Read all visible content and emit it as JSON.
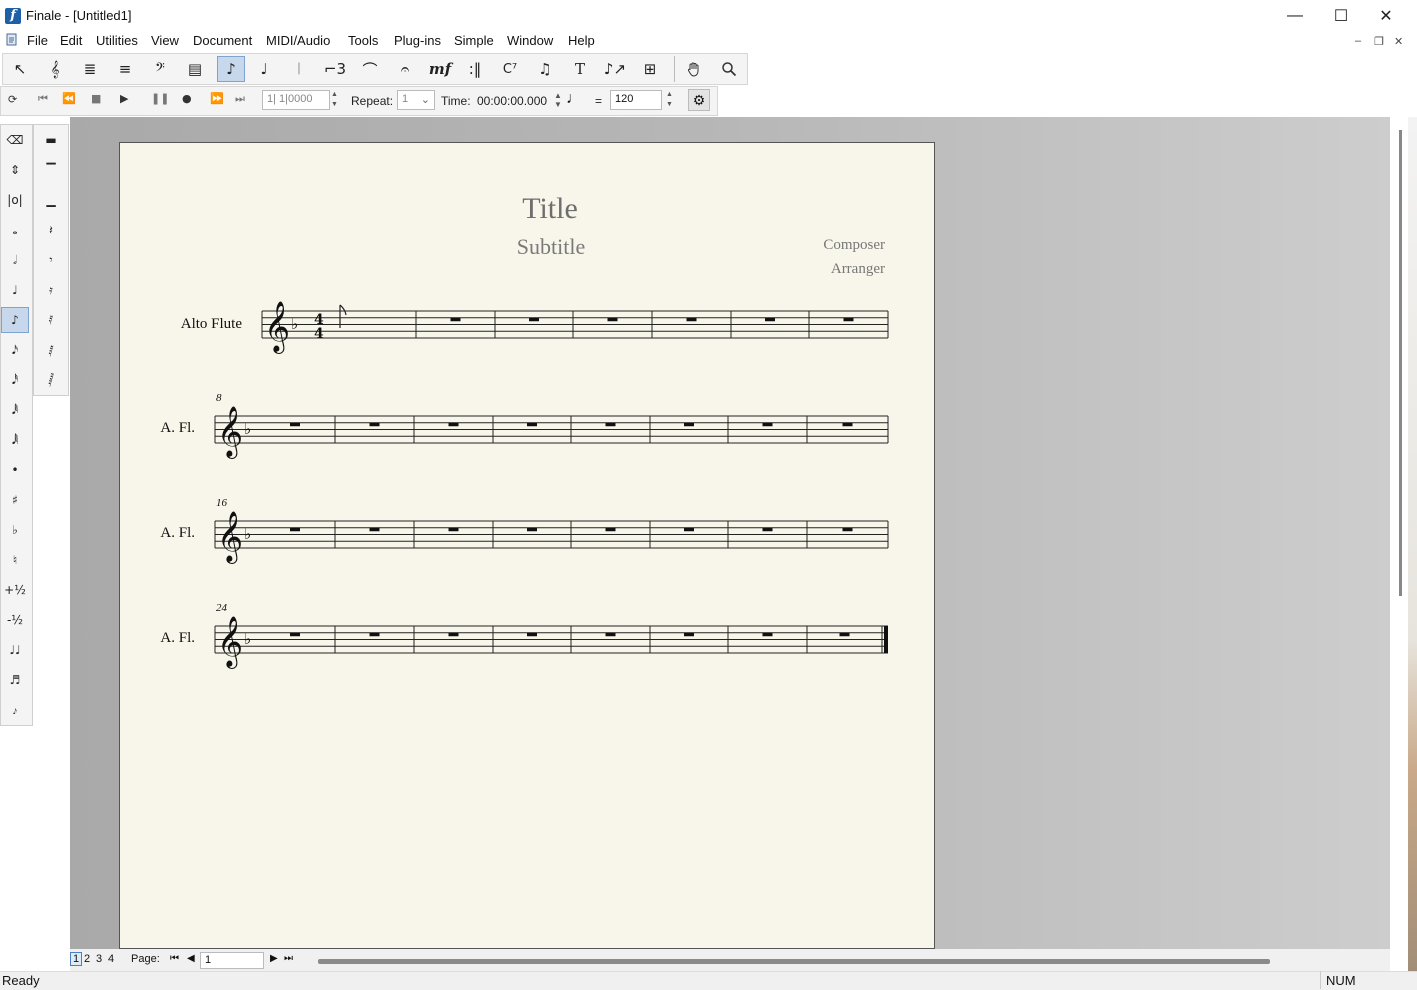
{
  "window": {
    "title": "Finale - [Untitled1]",
    "app_icon_glyph": "f"
  },
  "menu": [
    "File",
    "Edit",
    "Utilities",
    "View",
    "Document",
    "MIDI/Audio",
    "Tools",
    "Plug-ins",
    "Simple",
    "Window",
    "Help"
  ],
  "main_toolbar": [
    {
      "name": "selection-tool-icon",
      "glyph": "↖"
    },
    {
      "name": "staff-tool-icon",
      "glyph": "𝄞"
    },
    {
      "name": "simple-entry-staff-icon",
      "glyph": "≣"
    },
    {
      "name": "layer-staff-icon",
      "glyph": "≡"
    },
    {
      "name": "bass-clef-tool-icon",
      "glyph": "𝄢"
    },
    {
      "name": "measure-tool-icon",
      "glyph": "▤"
    },
    {
      "name": "simple-entry-tool-icon",
      "glyph": "♪",
      "active": true
    },
    {
      "name": "speedy-entry-tool-icon",
      "glyph": "♩"
    },
    {
      "name": "articulation-tool-icon",
      "glyph": "𝄀"
    },
    {
      "name": "tuplet-tool-icon",
      "glyph": "⌐3"
    },
    {
      "name": "smart-shape-tool-icon",
      "glyph": "⌒"
    },
    {
      "name": "fermata-tool-icon",
      "glyph": "𝄐"
    },
    {
      "name": "expression-tool-icon",
      "glyph": "mf"
    },
    {
      "name": "repeat-tool-icon",
      "glyph": ":‖"
    },
    {
      "name": "chord-tool-icon",
      "glyph": "C⁷"
    },
    {
      "name": "lyrics-tool-icon",
      "glyph": "♫"
    },
    {
      "name": "text-tool-icon",
      "glyph": "T"
    },
    {
      "name": "resize-tool-icon",
      "glyph": "♪↗"
    },
    {
      "name": "graphics-tool-icon",
      "glyph": "⊞"
    },
    {
      "name": "hand-grabber-icon",
      "glyph": "✋"
    },
    {
      "name": "zoom-icon",
      "glyph": "🔍"
    }
  ],
  "playback": {
    "counter": "1| 1|0000",
    "repeat_label": "Repeat:",
    "repeat_value": "1",
    "time_label": "Time:",
    "time_value": "00:00:00.000",
    "equals": "=",
    "tempo": "120"
  },
  "main_palette": [
    {
      "name": "eraser-icon",
      "glyph": "⌫"
    },
    {
      "name": "tie-icon",
      "glyph": "⇕"
    },
    {
      "name": "double-whole-note-icon",
      "glyph": "|o|"
    },
    {
      "name": "whole-note-icon",
      "glyph": "𝅝"
    },
    {
      "name": "half-note-icon",
      "glyph": "𝅗𝅥"
    },
    {
      "name": "quarter-note-icon",
      "glyph": "♩"
    },
    {
      "name": "eighth-note-icon",
      "glyph": "♪",
      "active": true
    },
    {
      "name": "sixteenth-note-icon",
      "glyph": "𝅘𝅥𝅯"
    },
    {
      "name": "thirty-second-note-icon",
      "glyph": "𝅘𝅥𝅰"
    },
    {
      "name": "sixty-fourth-note-icon",
      "glyph": "𝅘𝅥𝅱"
    },
    {
      "name": "128th-note-icon",
      "glyph": "𝅘𝅥𝅲"
    },
    {
      "name": "dot-icon",
      "glyph": "•"
    },
    {
      "name": "sharp-icon",
      "glyph": "♯"
    },
    {
      "name": "flat-icon",
      "glyph": "♭"
    },
    {
      "name": "natural-icon",
      "glyph": "♮"
    },
    {
      "name": "half-step-up-icon",
      "glyph": "+½"
    },
    {
      "name": "half-step-down-icon",
      "glyph": "-½"
    },
    {
      "name": "tie-notes-icon",
      "glyph": "♩♩"
    },
    {
      "name": "tuplet-entry-icon",
      "glyph": "♬"
    },
    {
      "name": "grace-note-icon",
      "glyph": "𝆔"
    }
  ],
  "sub_palette": [
    {
      "name": "double-whole-rest-icon",
      "glyph": "▬"
    },
    {
      "name": "whole-rest-icon",
      "glyph": "▔"
    },
    {
      "name": "half-rest-icon",
      "glyph": "▁"
    },
    {
      "name": "quarter-rest-icon",
      "glyph": "𝄽"
    },
    {
      "name": "eighth-rest-icon",
      "glyph": "𝄾"
    },
    {
      "name": "sixteenth-rest-icon",
      "glyph": "𝄿"
    },
    {
      "name": "thirty-second-rest-icon",
      "glyph": "𝅀"
    },
    {
      "name": "sixty-fourth-rest-icon",
      "glyph": "𝅁"
    },
    {
      "name": "128th-rest-icon",
      "glyph": "𝅂"
    }
  ],
  "score": {
    "title": "Title",
    "subtitle": "Subtitle",
    "composer": "Composer",
    "arranger": "Arranger",
    "systems": [
      {
        "label": "Alto Flute",
        "measure_number": ""
      },
      {
        "label": "A. Fl.",
        "measure_number": "8"
      },
      {
        "label": "A. Fl.",
        "measure_number": "16"
      },
      {
        "label": "A. Fl.",
        "measure_number": "24"
      }
    ]
  },
  "page_nav": {
    "tabs": [
      "1",
      "2",
      "3",
      "4"
    ],
    "page_label": "Page:",
    "page_value": "1"
  },
  "status": {
    "left": "Ready",
    "right": "NUM"
  }
}
